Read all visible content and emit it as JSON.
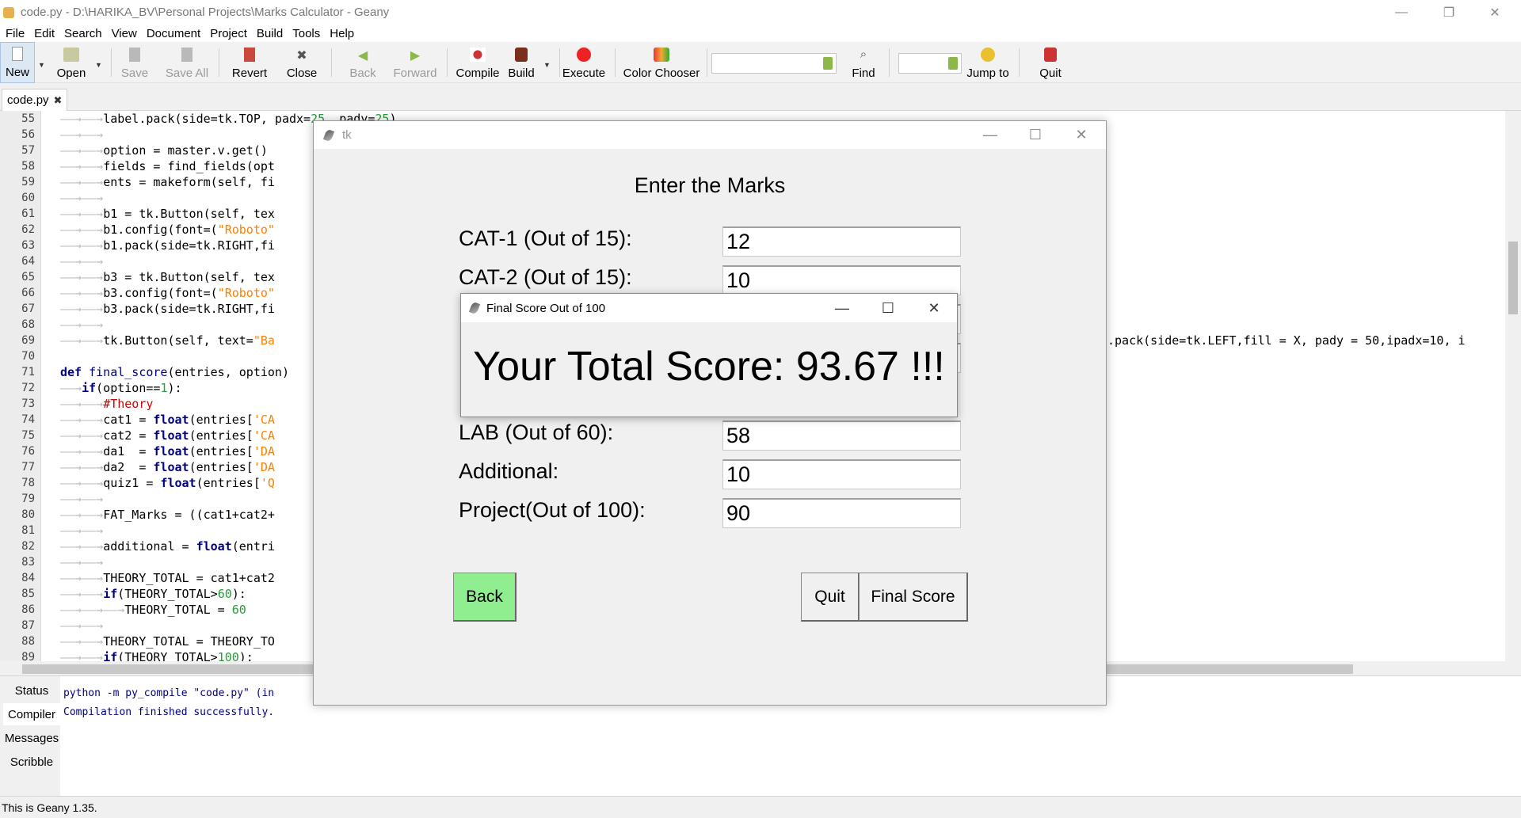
{
  "window": {
    "title": "code.py - D:\\HARIKA_BV\\Personal Projects\\Marks Calculator - Geany",
    "minimize": "—",
    "maximize": "❐",
    "close": "✕"
  },
  "menu": {
    "file": "File",
    "edit": "Edit",
    "search": "Search",
    "view": "View",
    "document": "Document",
    "project": "Project",
    "build": "Build",
    "tools": "Tools",
    "help": "Help"
  },
  "toolbar": {
    "new": "New",
    "open": "Open",
    "save": "Save",
    "save_all": "Save All",
    "revert": "Revert",
    "close": "Close",
    "back": "Back",
    "forward": "Forward",
    "compile": "Compile",
    "build": "Build",
    "execute": "Execute",
    "color_chooser": "Color Chooser",
    "find": "Find",
    "jump_to": "Jump to",
    "quit": "Quit",
    "search_value": "",
    "jump_value": ""
  },
  "tabs": {
    "active": "code.py",
    "close_glyph": "✖"
  },
  "editor": {
    "line_numbers": [
      "55",
      "56",
      "57",
      "58",
      "59",
      "60",
      "61",
      "62",
      "63",
      "64",
      "65",
      "66",
      "67",
      "68",
      "69",
      "70",
      "71",
      "72",
      "73",
      "74",
      "75",
      "76",
      "77",
      "78",
      "79",
      "80",
      "81",
      "82",
      "83",
      "84",
      "85",
      "86",
      "87",
      "88",
      "89"
    ],
    "right_overflow_line": ".pack(side=tk.LEFT,fill = X, pady = 50,ipadx=10, i"
  },
  "bottom_panel": {
    "tabs": [
      "Status",
      "Compiler",
      "Messages",
      "Scribble"
    ],
    "messages": [
      "python -m py_compile \"code.py\" (in",
      "Compilation finished successfully."
    ]
  },
  "statusbar": {
    "text": "This is Geany 1.35."
  },
  "tk_window": {
    "title": "tk",
    "heading": "Enter the Marks",
    "fields": [
      {
        "label": "CAT-1 (Out of 15):",
        "value": "12"
      },
      {
        "label": "CAT-2 (Out of 15):",
        "value": "10"
      },
      {
        "label": "LAB (Out of 60):",
        "value": "58"
      },
      {
        "label": "Additional:",
        "value": "10"
      },
      {
        "label": "Project(Out of 100):",
        "value": "90"
      }
    ],
    "back": "Back",
    "quit": "Quit",
    "final_score": "Final Score",
    "back_color": "#90ee90"
  },
  "score_dialog": {
    "title": "Final Score Out of 100",
    "message": "Your Total Score: 93.67 !!!"
  }
}
